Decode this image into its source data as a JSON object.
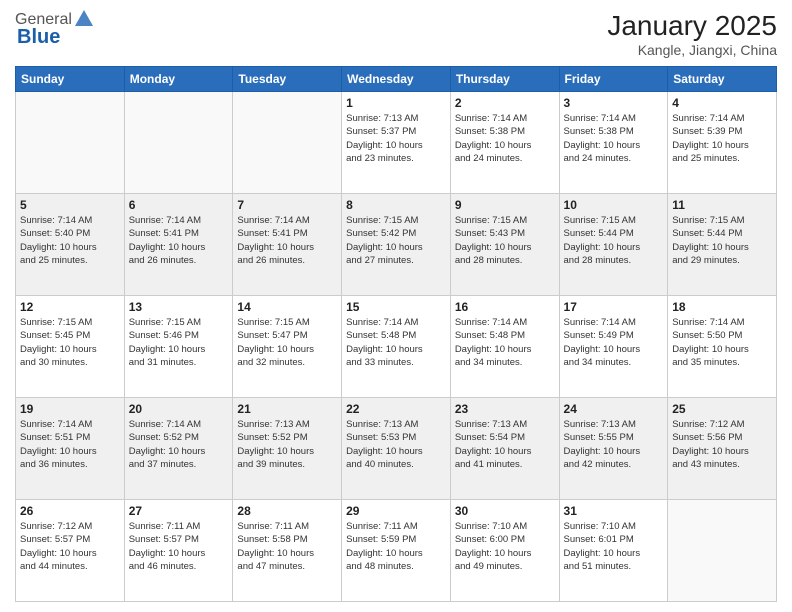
{
  "logo": {
    "general": "General",
    "blue": "Blue"
  },
  "header": {
    "title": "January 2025",
    "location": "Kangle, Jiangxi, China"
  },
  "days_of_week": [
    "Sunday",
    "Monday",
    "Tuesday",
    "Wednesday",
    "Thursday",
    "Friday",
    "Saturday"
  ],
  "weeks": [
    [
      {
        "day": "",
        "info": ""
      },
      {
        "day": "",
        "info": ""
      },
      {
        "day": "",
        "info": ""
      },
      {
        "day": "1",
        "info": "Sunrise: 7:13 AM\nSunset: 5:37 PM\nDaylight: 10 hours\nand 23 minutes."
      },
      {
        "day": "2",
        "info": "Sunrise: 7:14 AM\nSunset: 5:38 PM\nDaylight: 10 hours\nand 24 minutes."
      },
      {
        "day": "3",
        "info": "Sunrise: 7:14 AM\nSunset: 5:38 PM\nDaylight: 10 hours\nand 24 minutes."
      },
      {
        "day": "4",
        "info": "Sunrise: 7:14 AM\nSunset: 5:39 PM\nDaylight: 10 hours\nand 25 minutes."
      }
    ],
    [
      {
        "day": "5",
        "info": "Sunrise: 7:14 AM\nSunset: 5:40 PM\nDaylight: 10 hours\nand 25 minutes."
      },
      {
        "day": "6",
        "info": "Sunrise: 7:14 AM\nSunset: 5:41 PM\nDaylight: 10 hours\nand 26 minutes."
      },
      {
        "day": "7",
        "info": "Sunrise: 7:14 AM\nSunset: 5:41 PM\nDaylight: 10 hours\nand 26 minutes."
      },
      {
        "day": "8",
        "info": "Sunrise: 7:15 AM\nSunset: 5:42 PM\nDaylight: 10 hours\nand 27 minutes."
      },
      {
        "day": "9",
        "info": "Sunrise: 7:15 AM\nSunset: 5:43 PM\nDaylight: 10 hours\nand 28 minutes."
      },
      {
        "day": "10",
        "info": "Sunrise: 7:15 AM\nSunset: 5:44 PM\nDaylight: 10 hours\nand 28 minutes."
      },
      {
        "day": "11",
        "info": "Sunrise: 7:15 AM\nSunset: 5:44 PM\nDaylight: 10 hours\nand 29 minutes."
      }
    ],
    [
      {
        "day": "12",
        "info": "Sunrise: 7:15 AM\nSunset: 5:45 PM\nDaylight: 10 hours\nand 30 minutes."
      },
      {
        "day": "13",
        "info": "Sunrise: 7:15 AM\nSunset: 5:46 PM\nDaylight: 10 hours\nand 31 minutes."
      },
      {
        "day": "14",
        "info": "Sunrise: 7:15 AM\nSunset: 5:47 PM\nDaylight: 10 hours\nand 32 minutes."
      },
      {
        "day": "15",
        "info": "Sunrise: 7:14 AM\nSunset: 5:48 PM\nDaylight: 10 hours\nand 33 minutes."
      },
      {
        "day": "16",
        "info": "Sunrise: 7:14 AM\nSunset: 5:48 PM\nDaylight: 10 hours\nand 34 minutes."
      },
      {
        "day": "17",
        "info": "Sunrise: 7:14 AM\nSunset: 5:49 PM\nDaylight: 10 hours\nand 34 minutes."
      },
      {
        "day": "18",
        "info": "Sunrise: 7:14 AM\nSunset: 5:50 PM\nDaylight: 10 hours\nand 35 minutes."
      }
    ],
    [
      {
        "day": "19",
        "info": "Sunrise: 7:14 AM\nSunset: 5:51 PM\nDaylight: 10 hours\nand 36 minutes."
      },
      {
        "day": "20",
        "info": "Sunrise: 7:14 AM\nSunset: 5:52 PM\nDaylight: 10 hours\nand 37 minutes."
      },
      {
        "day": "21",
        "info": "Sunrise: 7:13 AM\nSunset: 5:52 PM\nDaylight: 10 hours\nand 39 minutes."
      },
      {
        "day": "22",
        "info": "Sunrise: 7:13 AM\nSunset: 5:53 PM\nDaylight: 10 hours\nand 40 minutes."
      },
      {
        "day": "23",
        "info": "Sunrise: 7:13 AM\nSunset: 5:54 PM\nDaylight: 10 hours\nand 41 minutes."
      },
      {
        "day": "24",
        "info": "Sunrise: 7:13 AM\nSunset: 5:55 PM\nDaylight: 10 hours\nand 42 minutes."
      },
      {
        "day": "25",
        "info": "Sunrise: 7:12 AM\nSunset: 5:56 PM\nDaylight: 10 hours\nand 43 minutes."
      }
    ],
    [
      {
        "day": "26",
        "info": "Sunrise: 7:12 AM\nSunset: 5:57 PM\nDaylight: 10 hours\nand 44 minutes."
      },
      {
        "day": "27",
        "info": "Sunrise: 7:11 AM\nSunset: 5:57 PM\nDaylight: 10 hours\nand 46 minutes."
      },
      {
        "day": "28",
        "info": "Sunrise: 7:11 AM\nSunset: 5:58 PM\nDaylight: 10 hours\nand 47 minutes."
      },
      {
        "day": "29",
        "info": "Sunrise: 7:11 AM\nSunset: 5:59 PM\nDaylight: 10 hours\nand 48 minutes."
      },
      {
        "day": "30",
        "info": "Sunrise: 7:10 AM\nSunset: 6:00 PM\nDaylight: 10 hours\nand 49 minutes."
      },
      {
        "day": "31",
        "info": "Sunrise: 7:10 AM\nSunset: 6:01 PM\nDaylight: 10 hours\nand 51 minutes."
      },
      {
        "day": "",
        "info": ""
      }
    ]
  ]
}
